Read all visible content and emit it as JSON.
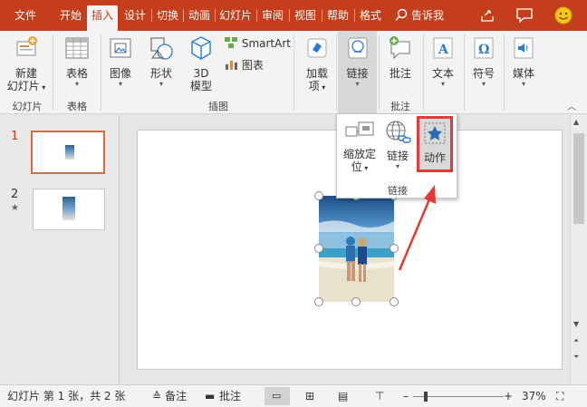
{
  "tabs": [
    {
      "label": "文件",
      "active": false
    },
    {
      "label": "开始",
      "active": false
    },
    {
      "label": "插入",
      "active": true
    },
    {
      "label": "设计",
      "active": false
    },
    {
      "label": "切换",
      "active": false
    },
    {
      "label": "动画",
      "active": false
    },
    {
      "label": "幻灯片",
      "active": false
    },
    {
      "label": "审阅",
      "active": false
    },
    {
      "label": "视图",
      "active": false
    },
    {
      "label": "帮助",
      "active": false
    },
    {
      "label": "格式",
      "active": false
    }
  ],
  "search": {
    "label": "告诉我"
  },
  "ribbon": {
    "new_slide": {
      "line1": "新建",
      "line2": "幻灯片"
    },
    "table": {
      "label": "表格"
    },
    "image": {
      "label": "图像"
    },
    "shapes": {
      "label": "形状"
    },
    "model3d": {
      "line1": "3D",
      "line2": "模型"
    },
    "smartart": {
      "label": "SmartArt"
    },
    "chart": {
      "label": "图表"
    },
    "addins": {
      "line1": "加载",
      "line2": "项"
    },
    "link": {
      "label": "链接"
    },
    "comment": {
      "label": "批注"
    },
    "text": {
      "label": "文本"
    },
    "symbol": {
      "label": "符号"
    },
    "media": {
      "label": "媒体"
    },
    "groups": {
      "slides": "幻灯片",
      "tables": "表格",
      "illustrations": "插图",
      "comments": "批注"
    }
  },
  "dropdown": {
    "zoom": {
      "line1": "缩放定",
      "line2": "位"
    },
    "link": {
      "label": "链接"
    },
    "action": {
      "label": "动作"
    },
    "group_label": "链接"
  },
  "thumbnails": [
    {
      "number": "1",
      "selected": true
    },
    {
      "number": "2",
      "selected": false,
      "marker": "★"
    }
  ],
  "status": {
    "slide_info": "幻灯片 第 1 张，共 2 张",
    "notes": "备注",
    "comments": "批注",
    "zoom": "37%"
  },
  "colors": {
    "accent": "#c43e1c",
    "highlight_box": "#e03a3a",
    "arrow": "#e53935"
  }
}
